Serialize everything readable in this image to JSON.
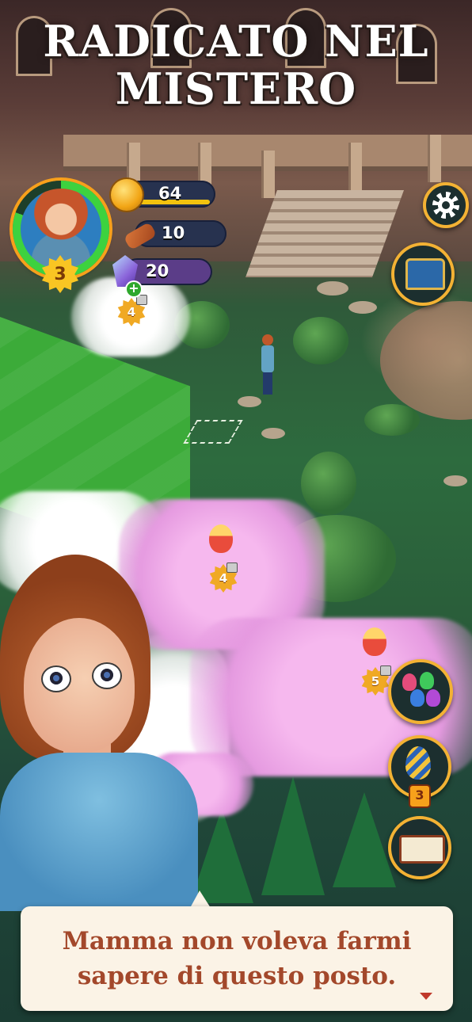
{
  "title": {
    "line1": "RADICATO NEL",
    "line2": "MISTERO"
  },
  "player": {
    "level": "3"
  },
  "resources": {
    "coins": {
      "value": "64",
      "icon": "coin-icon",
      "fill": 0.9,
      "color": "#f2c20f"
    },
    "wood": {
      "value": "10",
      "icon": "wood-log-icon"
    },
    "gems": {
      "value": "20",
      "icon": "gem-icon"
    }
  },
  "map": {
    "locks": [
      {
        "level": "4"
      },
      {
        "level": "4"
      },
      {
        "level": "5"
      }
    ]
  },
  "side_buttons": {
    "settings": "gear-icon",
    "chest": "treasure-chest-icon",
    "community": "people-icon",
    "egg": "egg-feather-icon",
    "egg_count": "3",
    "journal": "open-book-icon"
  },
  "dialog": {
    "line1": "Mamma non voleva farmi",
    "line2": "sapere di questo posto."
  },
  "colors": {
    "accent": "#f3b234",
    "dialog_text": "#a3482b",
    "dialog_bg": "#fbf3e6"
  }
}
